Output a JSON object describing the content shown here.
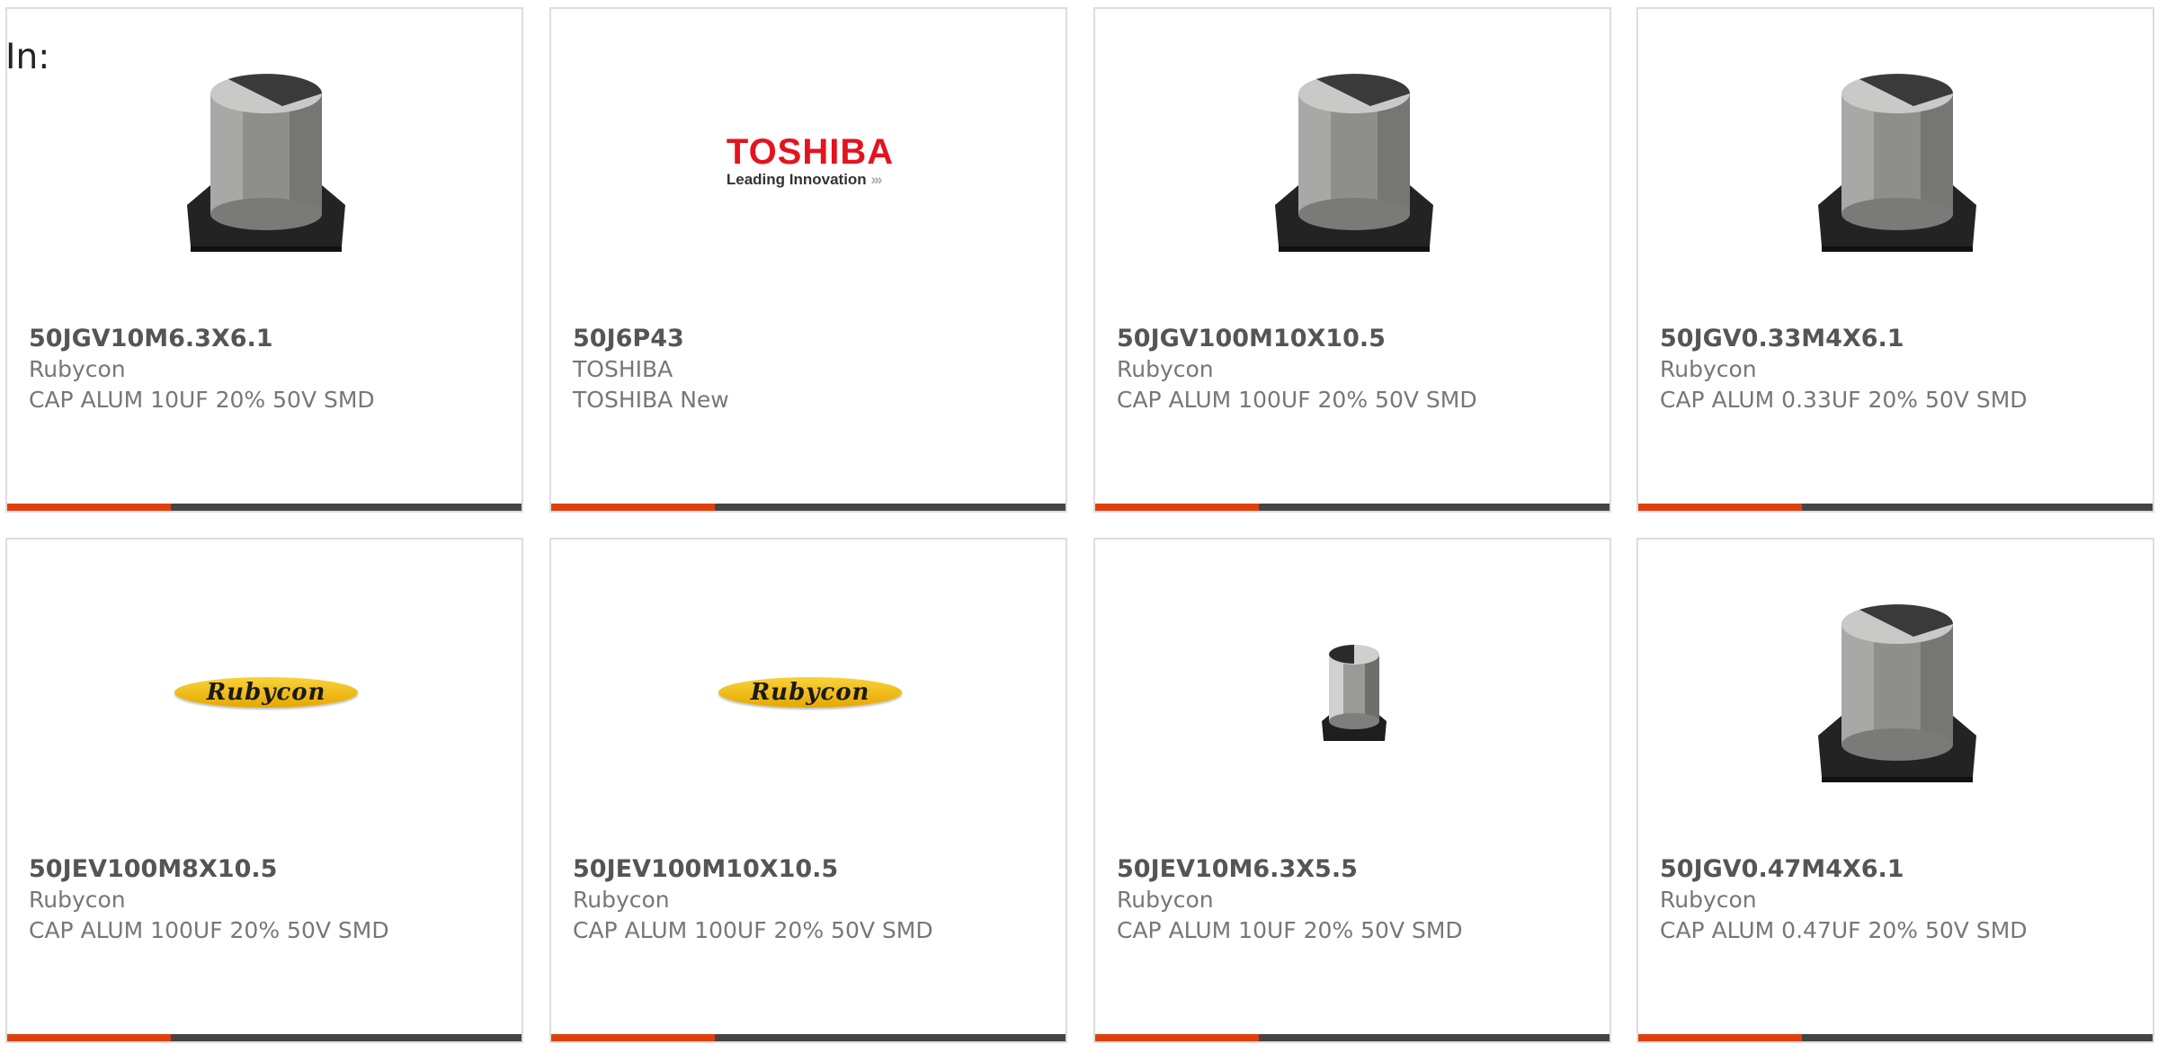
{
  "page": {
    "in_label": "In:"
  },
  "products": [
    {
      "part": "50JGV10M6.3X6.1",
      "brand": "Rubycon",
      "desc": "CAP ALUM 10UF 20% 50V SMD",
      "image": "capacitor-large-icon"
    },
    {
      "part": "50J6P43",
      "brand": "TOSHIBA",
      "desc": "TOSHIBA New",
      "image": "toshiba-logo",
      "logo_text": "TOSHIBA",
      "logo_tagline": "Leading Innovation"
    },
    {
      "part": "50JGV100M10X10.5",
      "brand": "Rubycon",
      "desc": "CAP ALUM 100UF 20% 50V SMD",
      "image": "capacitor-large-icon"
    },
    {
      "part": "50JGV0.33M4X6.1",
      "brand": "Rubycon",
      "desc": "CAP ALUM 0.33UF 20% 50V SMD",
      "image": "capacitor-large-icon"
    },
    {
      "part": "50JEV100M8X10.5",
      "brand": "Rubycon",
      "desc": "CAP ALUM 100UF 20% 50V SMD",
      "image": "rubycon-logo",
      "logo_text": "Rubycon"
    },
    {
      "part": "50JEV100M10X10.5",
      "brand": "Rubycon",
      "desc": "CAP ALUM 100UF 20% 50V SMD",
      "image": "rubycon-logo",
      "logo_text": "Rubycon"
    },
    {
      "part": "50JEV10M6.3X5.5",
      "brand": "Rubycon",
      "desc": "CAP ALUM 10UF 20% 50V SMD",
      "image": "capacitor-small-icon"
    },
    {
      "part": "50JGV0.47M4X6.1",
      "brand": "Rubycon",
      "desc": "CAP ALUM 0.47UF 20% 50V SMD",
      "image": "capacitor-large-icon"
    }
  ],
  "colors": {
    "accent": "#e04010",
    "bar": "#444444",
    "border": "#dddddd"
  }
}
